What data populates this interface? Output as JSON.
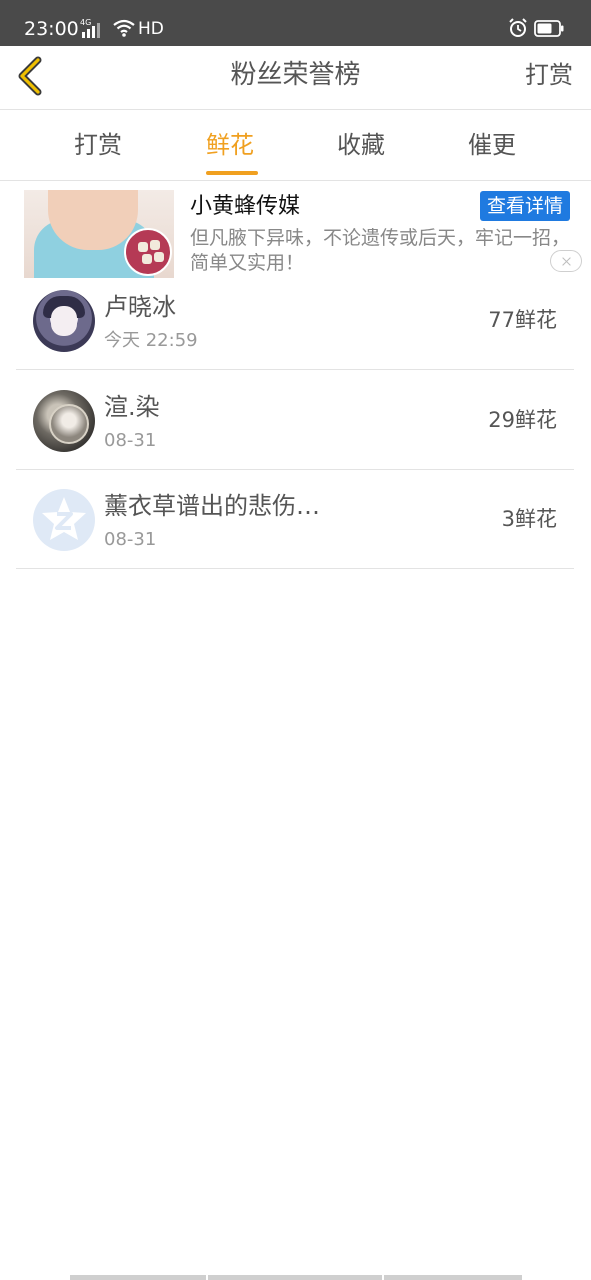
{
  "status_bar": {
    "time": "23:00",
    "network": "4G",
    "hd": "HD",
    "icons": [
      "signal-icon",
      "wifi-icon",
      "alarm-icon",
      "battery-icon"
    ],
    "battery_level": 0.7
  },
  "nav": {
    "title": "粉丝荣誉榜",
    "action": "打赏",
    "back_icon": "back-chevron-icon",
    "accent": "#f0a020"
  },
  "tabs": [
    {
      "label": "打赏",
      "active": false
    },
    {
      "label": "鲜花",
      "active": true
    },
    {
      "label": "收藏",
      "active": false
    },
    {
      "label": "催更",
      "active": false
    }
  ],
  "ad": {
    "title": "小黄蜂传媒",
    "button": "查看详情",
    "description": "但凡腋下异味，不论遗传或后天，牢记一招，简单又实用！",
    "button_color": "#1f7ae0"
  },
  "fans": [
    {
      "name": "卢晓冰",
      "time": "今天 22:59",
      "amount": "77鲜花"
    },
    {
      "name": "渲.染",
      "time": "08-31",
      "amount": "29鲜花"
    },
    {
      "name": "薰衣草谱出的悲伤…",
      "time": "08-31",
      "amount": "3鲜花"
    }
  ]
}
